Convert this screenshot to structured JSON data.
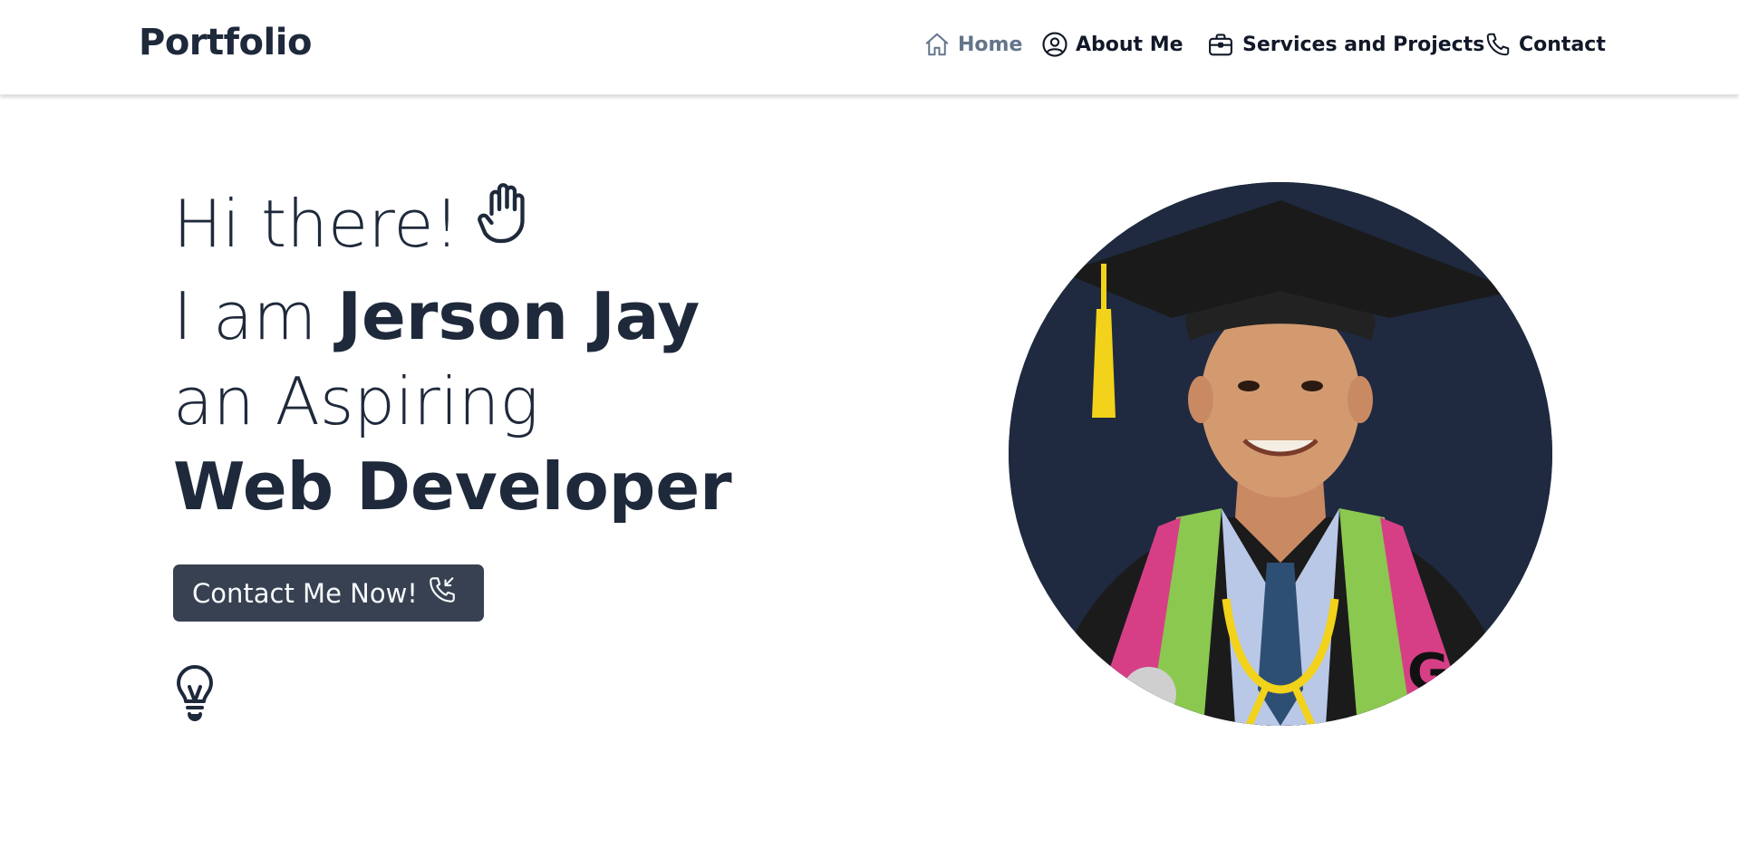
{
  "brand": {
    "title": "Portfolio"
  },
  "nav": {
    "items": [
      {
        "label": "Home",
        "icon": "home-icon",
        "active": true
      },
      {
        "label": "About Me",
        "icon": "user-circle-icon",
        "active": false
      },
      {
        "label": "Services and Projects",
        "icon": "briefcase-icon",
        "active": false
      },
      {
        "label": "Contact",
        "icon": "phone-icon",
        "active": false
      }
    ]
  },
  "hero": {
    "line1": "Hi there!",
    "line2_prefix": "I am ",
    "line2_name": "Jerson Jay",
    "line3": "an Aspiring",
    "line4": "Web Developer"
  },
  "cta": {
    "label": "Contact Me Now!",
    "icon": "phone-incoming-icon"
  },
  "icons": {
    "wave": "hand-wave-icon",
    "bulb": "lightbulb-icon"
  },
  "colors": {
    "text": "#1e293b",
    "nav_active": "#64748b",
    "button_bg": "#374151",
    "avatar_bg": "#1f2a40"
  }
}
